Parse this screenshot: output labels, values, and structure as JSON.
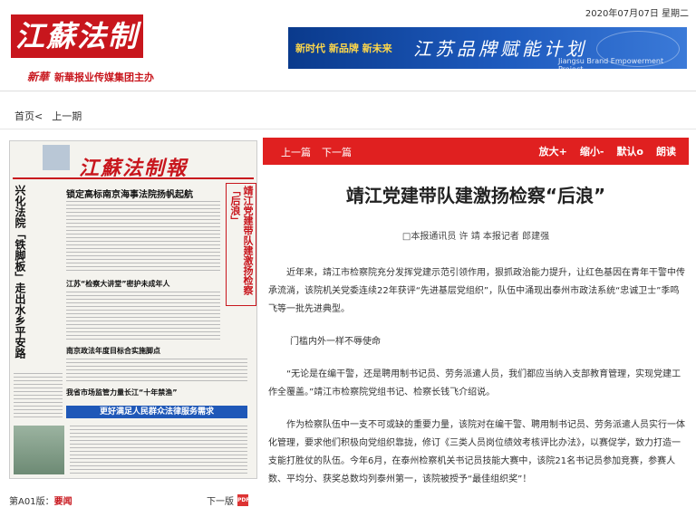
{
  "date": "2020年07月07日 星期二",
  "logo": {
    "name": "江蘇法制報",
    "sponsor": "新華报业传媒集团主办",
    "sponsor_mark": "新華"
  },
  "banner": {
    "slogan": "新时代 新品牌 新未来",
    "brand": "江苏品牌赋能计划",
    "sub": "Jiangsu Brand Empowerment Project"
  },
  "nav": {
    "home": "首页<",
    "prev_issue": "上一期"
  },
  "paper": {
    "masthead": "江蘇法制報",
    "left_vertical": "兴化法院「铁脚板」走出水乡平安路",
    "right_vertical": "靖江党建带队建激扬检察「后浪」",
    "headline1": "锁定高标南京海事法院扬帆起航",
    "headline2": "江苏“检察大讲堂”密护未成年人",
    "headline3": "南京政法年度目标合实施脚点",
    "headline4": "我省市场监管力量长江“十年禁渔”",
    "blue_bar": "更好满足人民群众法律服务需求"
  },
  "edition": {
    "label": "第A01版：",
    "name": "要闻"
  },
  "next_edition": "下一版",
  "pdf_icon_text": "PDF",
  "toolbar": {
    "prev": "上一篇",
    "next": "下一篇",
    "zoom_in": "放大+",
    "zoom_out": "缩小-",
    "default": "默认o",
    "read": "朗读"
  },
  "article": {
    "title": "靖江党建带队建激扬检察“后浪”",
    "byline": "□本报通讯员 许 靖 本报记者 郎建强",
    "p1": "近年来，靖江市检察院充分发挥党建示范引领作用，狠抓政治能力提升，让红色基因在青年干警中传承流淌，该院机关党委连续22年获评“先进基层党组织”，队伍中涌现出泰州市政法系统“忠诚卫士”季鸣飞等一批先进典型。",
    "p2": "门槛内外一样不辱使命",
    "p3": "“无论是在编干警，还是聘用制书记员、劳务派遣人员，我们都应当纳入支部教育管理，实现党建工作全覆盖。”靖江市检察院党组书记、检察长钱飞介绍说。",
    "p4": "作为检察队伍中一支不可或缺的重要力量，该院对在编干警、聘用制书记员、劳务派遣人员实行一体化管理，要求他们积极向党组织靠拢，修订《三类人员岗位绩效考核评比办法》，以赛促学，致力打造一支能打胜仗的队伍。今年6月，在泰州检察机关书记员技能大赛中，该院21名书记员参加竞赛，参赛人数、平均分、获奖总数均列泰州第一，该院被授予“最佳组织奖”！"
  }
}
